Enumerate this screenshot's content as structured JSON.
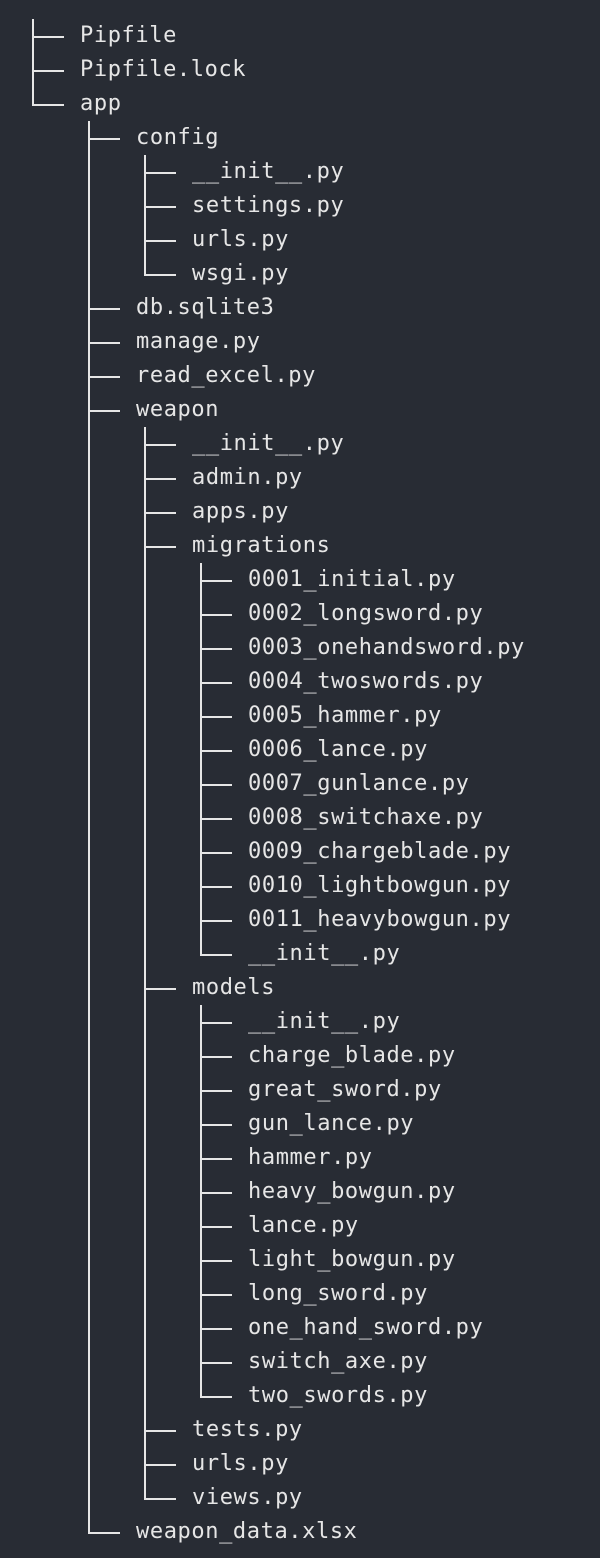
{
  "tree": [
    {
      "depth": 0,
      "name": "Pipfile"
    },
    {
      "depth": 0,
      "name": "Pipfile.lock"
    },
    {
      "depth": 0,
      "name": "app"
    },
    {
      "depth": 1,
      "name": "config"
    },
    {
      "depth": 2,
      "name": "__init__.py"
    },
    {
      "depth": 2,
      "name": "settings.py"
    },
    {
      "depth": 2,
      "name": "urls.py"
    },
    {
      "depth": 2,
      "name": "wsgi.py"
    },
    {
      "depth": 1,
      "name": "db.sqlite3"
    },
    {
      "depth": 1,
      "name": "manage.py"
    },
    {
      "depth": 1,
      "name": "read_excel.py"
    },
    {
      "depth": 1,
      "name": "weapon"
    },
    {
      "depth": 2,
      "name": "__init__.py"
    },
    {
      "depth": 2,
      "name": "admin.py"
    },
    {
      "depth": 2,
      "name": "apps.py"
    },
    {
      "depth": 2,
      "name": "migrations"
    },
    {
      "depth": 3,
      "name": "0001_initial.py"
    },
    {
      "depth": 3,
      "name": "0002_longsword.py"
    },
    {
      "depth": 3,
      "name": "0003_onehandsword.py"
    },
    {
      "depth": 3,
      "name": "0004_twoswords.py"
    },
    {
      "depth": 3,
      "name": "0005_hammer.py"
    },
    {
      "depth": 3,
      "name": "0006_lance.py"
    },
    {
      "depth": 3,
      "name": "0007_gunlance.py"
    },
    {
      "depth": 3,
      "name": "0008_switchaxe.py"
    },
    {
      "depth": 3,
      "name": "0009_chargeblade.py"
    },
    {
      "depth": 3,
      "name": "0010_lightbowgun.py"
    },
    {
      "depth": 3,
      "name": "0011_heavybowgun.py"
    },
    {
      "depth": 3,
      "name": "__init__.py"
    },
    {
      "depth": 2,
      "name": "models"
    },
    {
      "depth": 3,
      "name": "__init__.py"
    },
    {
      "depth": 3,
      "name": "charge_blade.py"
    },
    {
      "depth": 3,
      "name": "great_sword.py"
    },
    {
      "depth": 3,
      "name": "gun_lance.py"
    },
    {
      "depth": 3,
      "name": "hammer.py"
    },
    {
      "depth": 3,
      "name": "heavy_bowgun.py"
    },
    {
      "depth": 3,
      "name": "lance.py"
    },
    {
      "depth": 3,
      "name": "light_bowgun.py"
    },
    {
      "depth": 3,
      "name": "long_sword.py"
    },
    {
      "depth": 3,
      "name": "one_hand_sword.py"
    },
    {
      "depth": 3,
      "name": "switch_axe.py"
    },
    {
      "depth": 3,
      "name": "two_swords.py"
    },
    {
      "depth": 2,
      "name": "tests.py"
    },
    {
      "depth": 2,
      "name": "urls.py"
    },
    {
      "depth": 2,
      "name": "views.py"
    },
    {
      "depth": 1,
      "name": "weapon_data.xlsx"
    }
  ]
}
